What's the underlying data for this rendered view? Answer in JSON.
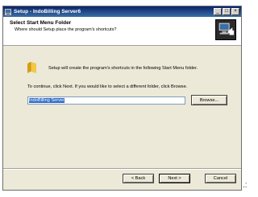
{
  "window": {
    "title": "Setup - IndoBilling Server6"
  },
  "title_buttons": {
    "minimize": "_",
    "maximize": "□",
    "close": "×"
  },
  "header": {
    "title": "Select Start Menu Folder",
    "subtitle": "Where should Setup place the program's shortcuts?"
  },
  "body": {
    "intro": "Setup will create the program's shortcuts in the following Start Menu folder.",
    "instruction": "To continue, click Next. If you would like to select a different folder, click Browse.",
    "folder_value": "IndoBilling Server",
    "browse_label": "Browse..."
  },
  "footer": {
    "back_label": "< Back",
    "next_label": "Next >",
    "cancel_label": "Cancel"
  },
  "edge_text": ".:"
}
